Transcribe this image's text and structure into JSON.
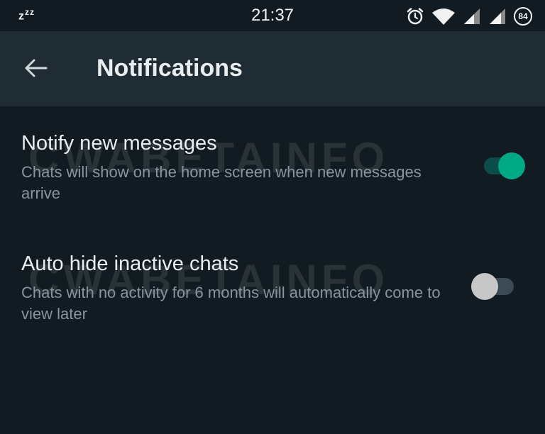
{
  "status_bar": {
    "sleep_indicator": "zzz",
    "time": "21:37",
    "battery_level": "84",
    "icons": [
      "alarm-icon",
      "wifi-icon",
      "signal-icon",
      "signal-icon",
      "battery-icon"
    ]
  },
  "app_bar": {
    "back_icon": "arrow-left-icon",
    "title": "Notifications"
  },
  "settings": [
    {
      "title": "Notify new messages",
      "description": "Chats will show on the home screen when new messages arrive",
      "enabled": true
    },
    {
      "title": "Auto hide inactive chats",
      "description": "Chats with no activity for 6 months will automatically come to view later",
      "enabled": false
    }
  ],
  "watermark": "CWABETAINFO",
  "colors": {
    "background": "#111b21",
    "app_bar": "#1f2c33",
    "accent": "#00a884",
    "toggle_track_on": "#0c4d4a",
    "toggle_thumb_off": "#c7c7c7",
    "secondary_text": "#8696a0"
  }
}
